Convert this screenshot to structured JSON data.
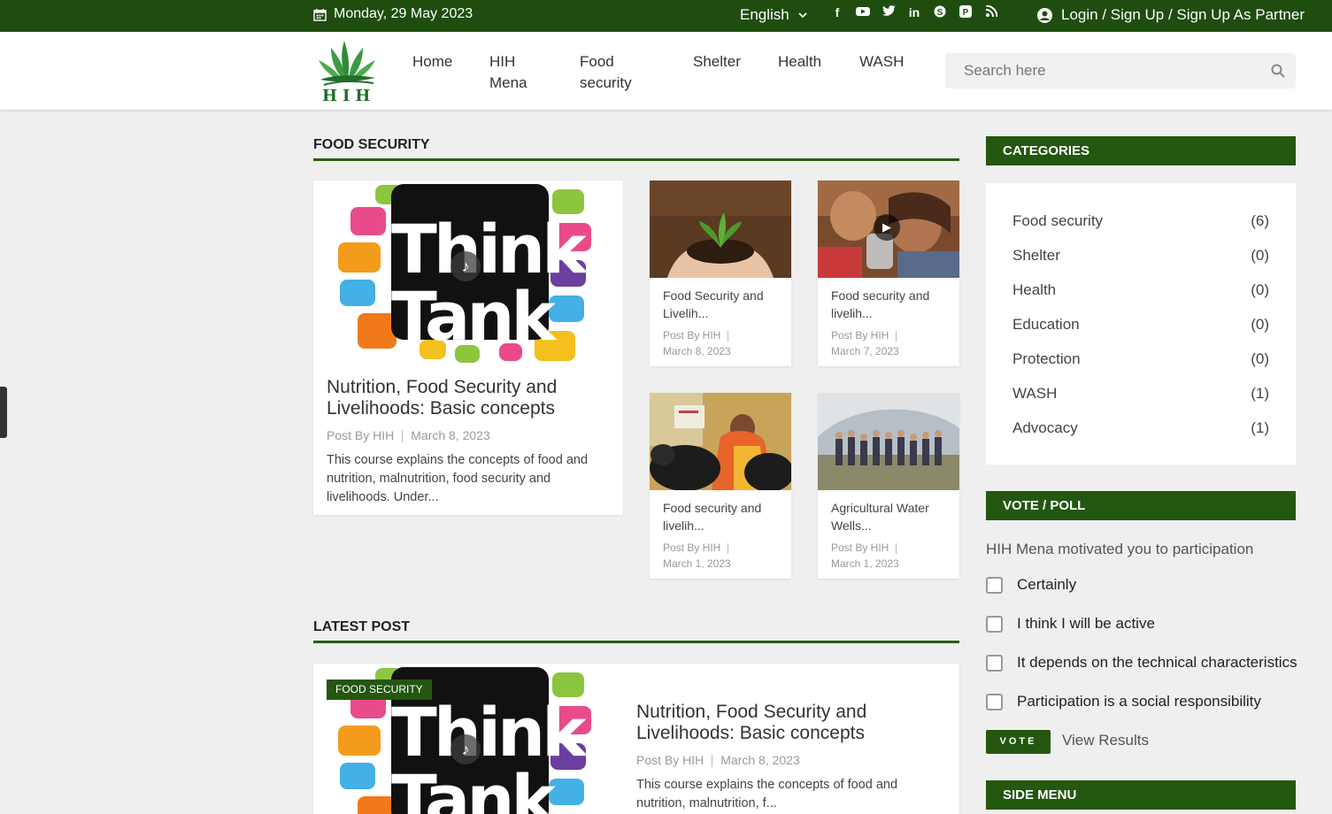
{
  "topbar": {
    "date": "Monday, 29 May 2023",
    "language": "English",
    "login": "Login / Sign Up / Sign Up As Partner",
    "socials": [
      "facebook-icon",
      "youtube-icon",
      "twitter-icon",
      "linkedin-icon",
      "skype-icon",
      "pinterest-icon",
      "rss-icon"
    ]
  },
  "brand": {
    "logo_text": "HIH"
  },
  "nav": {
    "items": [
      {
        "label": "Home"
      },
      {
        "label": "HIH Mena"
      },
      {
        "label": "Food security"
      },
      {
        "label": "Shelter"
      },
      {
        "label": "Health"
      },
      {
        "label": "WASH"
      }
    ]
  },
  "search": {
    "placeholder": "Search here"
  },
  "food_security": {
    "heading": "FOOD SECURITY",
    "featured": {
      "image_text": "Think Tank",
      "title": "Nutrition, Food Security and Livelihoods: Basic concepts",
      "author": "Post By HIH",
      "date": "March 8, 2023",
      "excerpt": "This course explains the concepts of food and nutrition, malnutrition, food security and livelihoods. Under..."
    },
    "cards": [
      {
        "title": "Food Security and Livelih...",
        "author": "Post By HIH",
        "date": "March 8, 2023"
      },
      {
        "title": "Food security and livelih...",
        "author": "Post By HIH",
        "date": "March 7, 2023"
      },
      {
        "title": "Food security and livelih...",
        "author": "Post By HIH",
        "date": "March 1, 2023"
      },
      {
        "title": "Agricultural Water Wells...",
        "author": "Post By HIH",
        "date": "March 1, 2023"
      }
    ]
  },
  "latest": {
    "heading": "LATEST POST",
    "badge": "FOOD SECURITY",
    "image_text": "Think Tank",
    "title": "Nutrition, Food Security and Livelihoods: Basic concepts",
    "author": "Post By HIH",
    "date": "March 8, 2023",
    "excerpt": "This course explains the concepts of food and nutrition, malnutrition, f..."
  },
  "sidebar": {
    "categories_heading": "CATEGORIES",
    "categories": [
      {
        "name": "Food security",
        "count": "(6)"
      },
      {
        "name": "Shelter",
        "count": "(0)"
      },
      {
        "name": "Health",
        "count": "(0)"
      },
      {
        "name": "Education",
        "count": "(0)"
      },
      {
        "name": "Protection",
        "count": "(0)"
      },
      {
        "name": "WASH",
        "count": "(1)"
      },
      {
        "name": "Advocacy",
        "count": "(1)"
      }
    ],
    "poll_heading": "VOTE / POLL",
    "poll_question": "HIH Mena motivated you to participation",
    "poll_options": [
      {
        "label": "Certainly"
      },
      {
        "label": "I think I will be active"
      },
      {
        "label": "It depends on the technical characteristics"
      },
      {
        "label": "Participation is a social responsibility"
      }
    ],
    "vote_label": "VOTE",
    "view_results": "View Results",
    "side_menu_heading": "SIDE MENU"
  },
  "colors": {
    "brand_green": "#1f4d0f",
    "accent_green": "#245710"
  }
}
